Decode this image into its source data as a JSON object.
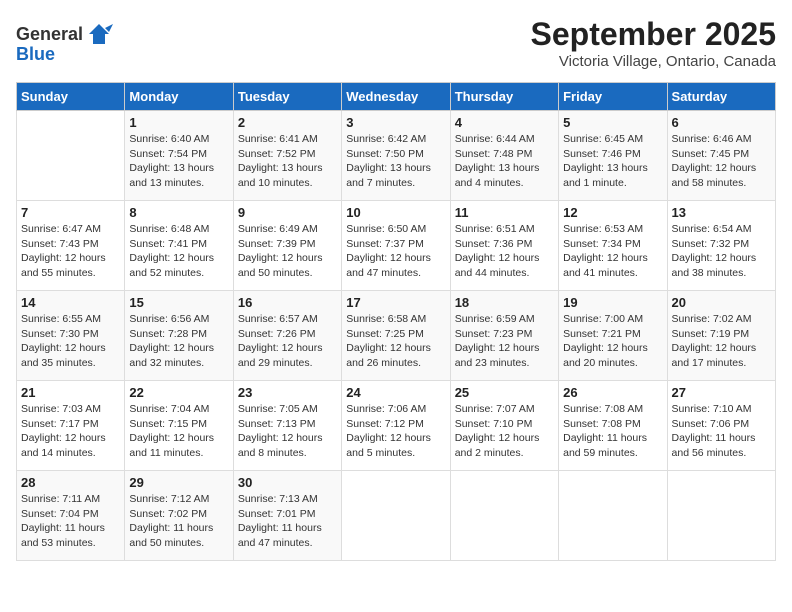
{
  "header": {
    "logo_general": "General",
    "logo_blue": "Blue",
    "title": "September 2025",
    "subtitle": "Victoria Village, Ontario, Canada"
  },
  "days_of_week": [
    "Sunday",
    "Monday",
    "Tuesday",
    "Wednesday",
    "Thursday",
    "Friday",
    "Saturday"
  ],
  "weeks": [
    [
      {
        "day": "",
        "info": ""
      },
      {
        "day": "1",
        "info": "Sunrise: 6:40 AM\nSunset: 7:54 PM\nDaylight: 13 hours\nand 13 minutes."
      },
      {
        "day": "2",
        "info": "Sunrise: 6:41 AM\nSunset: 7:52 PM\nDaylight: 13 hours\nand 10 minutes."
      },
      {
        "day": "3",
        "info": "Sunrise: 6:42 AM\nSunset: 7:50 PM\nDaylight: 13 hours\nand 7 minutes."
      },
      {
        "day": "4",
        "info": "Sunrise: 6:44 AM\nSunset: 7:48 PM\nDaylight: 13 hours\nand 4 minutes."
      },
      {
        "day": "5",
        "info": "Sunrise: 6:45 AM\nSunset: 7:46 PM\nDaylight: 13 hours\nand 1 minute."
      },
      {
        "day": "6",
        "info": "Sunrise: 6:46 AM\nSunset: 7:45 PM\nDaylight: 12 hours\nand 58 minutes."
      }
    ],
    [
      {
        "day": "7",
        "info": "Sunrise: 6:47 AM\nSunset: 7:43 PM\nDaylight: 12 hours\nand 55 minutes."
      },
      {
        "day": "8",
        "info": "Sunrise: 6:48 AM\nSunset: 7:41 PM\nDaylight: 12 hours\nand 52 minutes."
      },
      {
        "day": "9",
        "info": "Sunrise: 6:49 AM\nSunset: 7:39 PM\nDaylight: 12 hours\nand 50 minutes."
      },
      {
        "day": "10",
        "info": "Sunrise: 6:50 AM\nSunset: 7:37 PM\nDaylight: 12 hours\nand 47 minutes."
      },
      {
        "day": "11",
        "info": "Sunrise: 6:51 AM\nSunset: 7:36 PM\nDaylight: 12 hours\nand 44 minutes."
      },
      {
        "day": "12",
        "info": "Sunrise: 6:53 AM\nSunset: 7:34 PM\nDaylight: 12 hours\nand 41 minutes."
      },
      {
        "day": "13",
        "info": "Sunrise: 6:54 AM\nSunset: 7:32 PM\nDaylight: 12 hours\nand 38 minutes."
      }
    ],
    [
      {
        "day": "14",
        "info": "Sunrise: 6:55 AM\nSunset: 7:30 PM\nDaylight: 12 hours\nand 35 minutes."
      },
      {
        "day": "15",
        "info": "Sunrise: 6:56 AM\nSunset: 7:28 PM\nDaylight: 12 hours\nand 32 minutes."
      },
      {
        "day": "16",
        "info": "Sunrise: 6:57 AM\nSunset: 7:26 PM\nDaylight: 12 hours\nand 29 minutes."
      },
      {
        "day": "17",
        "info": "Sunrise: 6:58 AM\nSunset: 7:25 PM\nDaylight: 12 hours\nand 26 minutes."
      },
      {
        "day": "18",
        "info": "Sunrise: 6:59 AM\nSunset: 7:23 PM\nDaylight: 12 hours\nand 23 minutes."
      },
      {
        "day": "19",
        "info": "Sunrise: 7:00 AM\nSunset: 7:21 PM\nDaylight: 12 hours\nand 20 minutes."
      },
      {
        "day": "20",
        "info": "Sunrise: 7:02 AM\nSunset: 7:19 PM\nDaylight: 12 hours\nand 17 minutes."
      }
    ],
    [
      {
        "day": "21",
        "info": "Sunrise: 7:03 AM\nSunset: 7:17 PM\nDaylight: 12 hours\nand 14 minutes."
      },
      {
        "day": "22",
        "info": "Sunrise: 7:04 AM\nSunset: 7:15 PM\nDaylight: 12 hours\nand 11 minutes."
      },
      {
        "day": "23",
        "info": "Sunrise: 7:05 AM\nSunset: 7:13 PM\nDaylight: 12 hours\nand 8 minutes."
      },
      {
        "day": "24",
        "info": "Sunrise: 7:06 AM\nSunset: 7:12 PM\nDaylight: 12 hours\nand 5 minutes."
      },
      {
        "day": "25",
        "info": "Sunrise: 7:07 AM\nSunset: 7:10 PM\nDaylight: 12 hours\nand 2 minutes."
      },
      {
        "day": "26",
        "info": "Sunrise: 7:08 AM\nSunset: 7:08 PM\nDaylight: 11 hours\nand 59 minutes."
      },
      {
        "day": "27",
        "info": "Sunrise: 7:10 AM\nSunset: 7:06 PM\nDaylight: 11 hours\nand 56 minutes."
      }
    ],
    [
      {
        "day": "28",
        "info": "Sunrise: 7:11 AM\nSunset: 7:04 PM\nDaylight: 11 hours\nand 53 minutes."
      },
      {
        "day": "29",
        "info": "Sunrise: 7:12 AM\nSunset: 7:02 PM\nDaylight: 11 hours\nand 50 minutes."
      },
      {
        "day": "30",
        "info": "Sunrise: 7:13 AM\nSunset: 7:01 PM\nDaylight: 11 hours\nand 47 minutes."
      },
      {
        "day": "",
        "info": ""
      },
      {
        "day": "",
        "info": ""
      },
      {
        "day": "",
        "info": ""
      },
      {
        "day": "",
        "info": ""
      }
    ]
  ]
}
